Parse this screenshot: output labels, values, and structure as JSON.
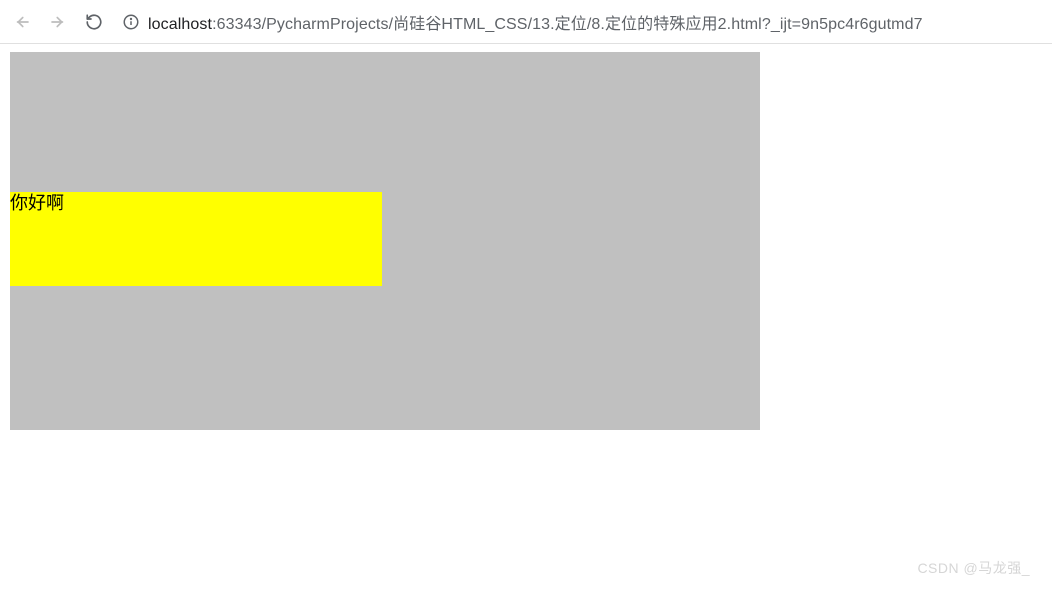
{
  "toolbar": {
    "url_host": "localhost",
    "url_port": ":63343",
    "url_path": "/PycharmProjects/尚硅谷HTML_CSS/13.定位/8.定位的特殊应用2.html?_ijt=9n5pc4r6gutmd7"
  },
  "page": {
    "inner_text": "你好啊"
  },
  "watermark": "CSDN @马龙强_"
}
